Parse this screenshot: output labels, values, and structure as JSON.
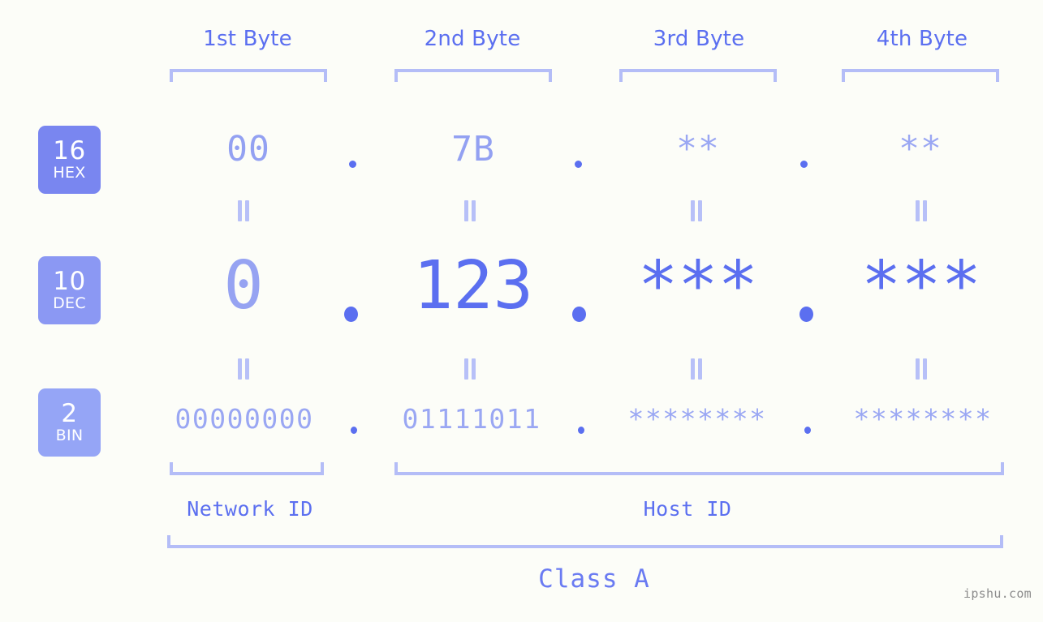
{
  "watermark": "ipshu.com",
  "colors": {
    "background": "#fcfdf8",
    "accent_strong": "#5b6ff0",
    "accent_light": "#93a1f2",
    "bracket": "#b4bdf7",
    "badge_hex": "#7986f0",
    "badge_dec": "#8b98f3",
    "badge_bin": "#95a5f6",
    "watermark": "#8c8c8c"
  },
  "byte_headers": [
    {
      "label": "1st Byte"
    },
    {
      "label": "2nd Byte"
    },
    {
      "label": "3rd Byte"
    },
    {
      "label": "4th Byte"
    }
  ],
  "bases": [
    {
      "number": "16",
      "abbr": "HEX"
    },
    {
      "number": "10",
      "abbr": "DEC"
    },
    {
      "number": "2",
      "abbr": "BIN"
    }
  ],
  "rows": {
    "hex": {
      "base_number": "16",
      "base_abbr": "HEX",
      "values": [
        "00",
        "7B",
        "**",
        "**"
      ],
      "separator": "."
    },
    "dec": {
      "base_number": "10",
      "base_abbr": "DEC",
      "values": [
        "0",
        "123",
        "***",
        "***"
      ],
      "separator": "."
    },
    "bin": {
      "base_number": "2",
      "base_abbr": "BIN",
      "values": [
        "00000000",
        "01111011",
        "********",
        "********"
      ],
      "separator": "."
    }
  },
  "equals_symbol": "=",
  "regions": [
    {
      "label": "Network ID"
    },
    {
      "label": "Host ID"
    }
  ],
  "class_label": "Class A"
}
